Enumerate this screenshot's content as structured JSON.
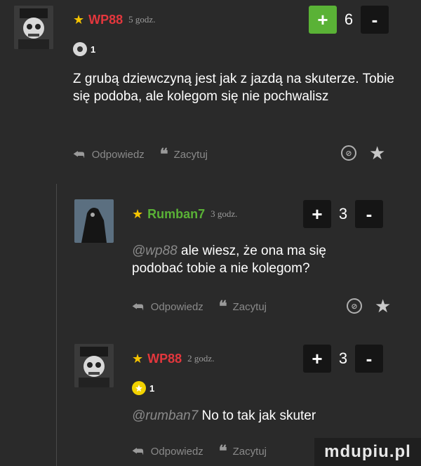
{
  "colors": {
    "red_nick": "#e2373d",
    "green_nick": "#5ab236",
    "star": "#f5c400",
    "vote_active": "#5ab236"
  },
  "comments": [
    {
      "nick": "WP88",
      "time": "5 godz.",
      "plus": "+",
      "votes": "6",
      "minus": "-",
      "medal_count": "1",
      "text": "Z grubą dziewczyną jest jak z jazdą na skuterze. Tobie się podoba, ale kolegom się nie pochwalisz",
      "reply": "Odpowiedz",
      "quote": "Zacytuj"
    },
    {
      "nick": "Rumban7",
      "time": "3 godz.",
      "plus": "+",
      "votes": "3",
      "minus": "-",
      "mention": "@wp88",
      "text": " ale wiesz, że ona ma się podobać tobie a nie kolegom?",
      "reply": "Odpowiedz",
      "quote": "Zacytuj"
    },
    {
      "nick": "WP88",
      "time": "2 godz.",
      "plus": "+",
      "votes": "3",
      "minus": "-",
      "medal_count": "1",
      "mention": "@rumban7",
      "text": " No to tak jak skuter",
      "reply": "Odpowiedz",
      "quote": "Zacytuj"
    }
  ],
  "watermark": "mdupiu.pl"
}
